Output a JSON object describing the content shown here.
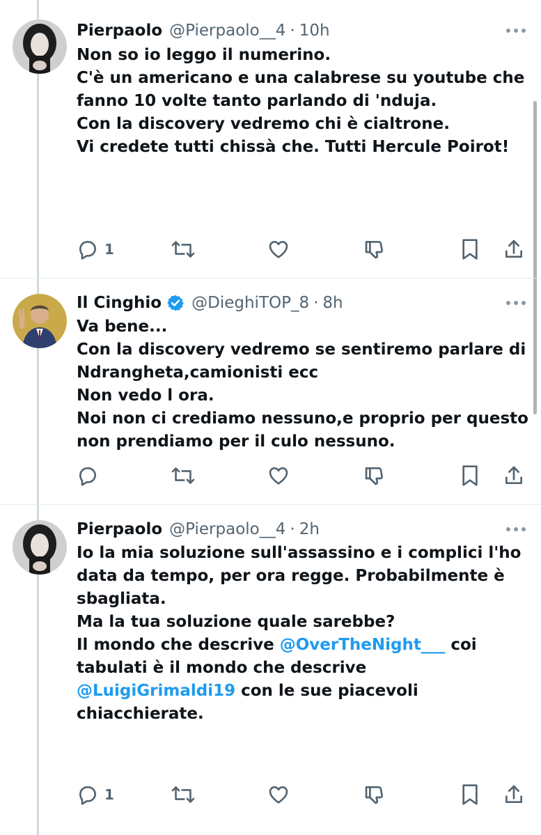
{
  "tweets": [
    {
      "name": "Pierpaolo",
      "handle": "@Pierpaolo__4",
      "dot": "·",
      "time": "10h",
      "verified": false,
      "text": [
        "Non so io leggo il numerino.",
        "",
        "C'è un americano e una calabrese su youtube che fanno 10 volte tanto parlando di 'nduja.",
        "",
        "Con la discovery vedremo chi è cialtrone.",
        "",
        "Vi credete tutti chissà che. Tutti Hercule Poirot!"
      ],
      "reply_count": "1"
    },
    {
      "name": "Il Cinghio",
      "handle": "@DieghiTOP_8",
      "dot": "·",
      "time": "8h",
      "verified": true,
      "text": [
        "Va bene...",
        "Con la discovery vedremo se sentiremo parlare di Ndrangheta,camionisti ecc",
        "Non vedo l ora.",
        "Noi non ci crediamo nessuno,e proprio per questo non prendiamo per il culo nessuno."
      ],
      "reply_count": ""
    },
    {
      "name": "Pierpaolo",
      "handle": "@Pierpaolo__4",
      "dot": "·",
      "time": "2h",
      "verified": false,
      "text_intro": [
        "Io la mia soluzione sull'assassino e i complici l'ho data da tempo, per ora regge. Probabilmente è sbagliata.",
        "",
        "Ma la tua soluzione quale sarebbe?",
        ""
      ],
      "text_mention_parts": {
        "a": "Il mondo che descrive ",
        "m1": "@OverTheNight___",
        "b": " coi tabulati è il mondo che descrive ",
        "m2": "@LuigiGrimaldi19",
        "c": " con le sue piacevoli chiacchierate."
      },
      "reply_count": "1"
    }
  ],
  "icons": {
    "reply": "reply-icon",
    "retweet": "retweet-icon",
    "like": "heart-icon",
    "downvote": "downvote-icon",
    "bookmark": "bookmark-icon",
    "share": "share-icon",
    "more": "more-icon",
    "verified": "verified-badge-icon"
  },
  "colors": {
    "text": "#0f1419",
    "secondary": "#536471",
    "link": "#1d9bf0",
    "thread_line": "#cfd9de"
  }
}
